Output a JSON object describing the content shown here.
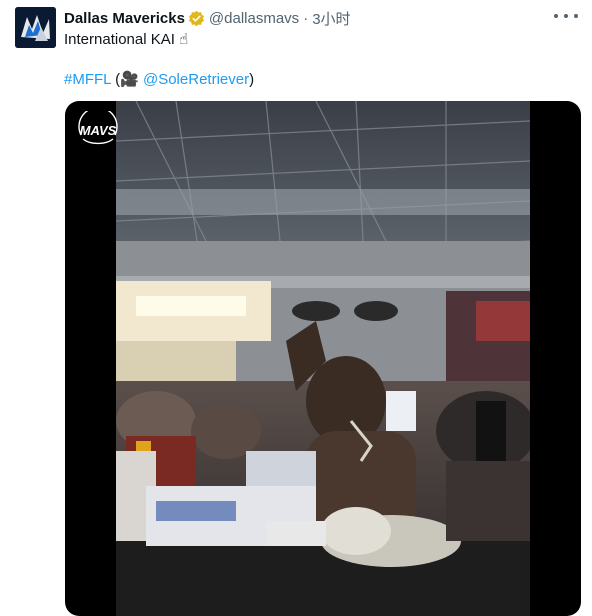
{
  "tweet": {
    "display_name": "Dallas Mavericks",
    "handle": "@dallasmavs",
    "separator": "·",
    "time": "3小时",
    "text_line1": "International KAI ☝",
    "hashtag": "#MFFL",
    "open_paren": " (",
    "camera_emoji": "🎥",
    "mention_space": " ",
    "mention": "@SoleRetriever",
    "close_paren": ")"
  },
  "media": {
    "watermark": "MAVS",
    "type": "video"
  },
  "icons": {
    "verified": "verified-badge-icon",
    "more": "more-options-icon"
  },
  "colors": {
    "link": "#1d9bf0",
    "verified_gold": "#e2b719",
    "muted": "#536471"
  }
}
